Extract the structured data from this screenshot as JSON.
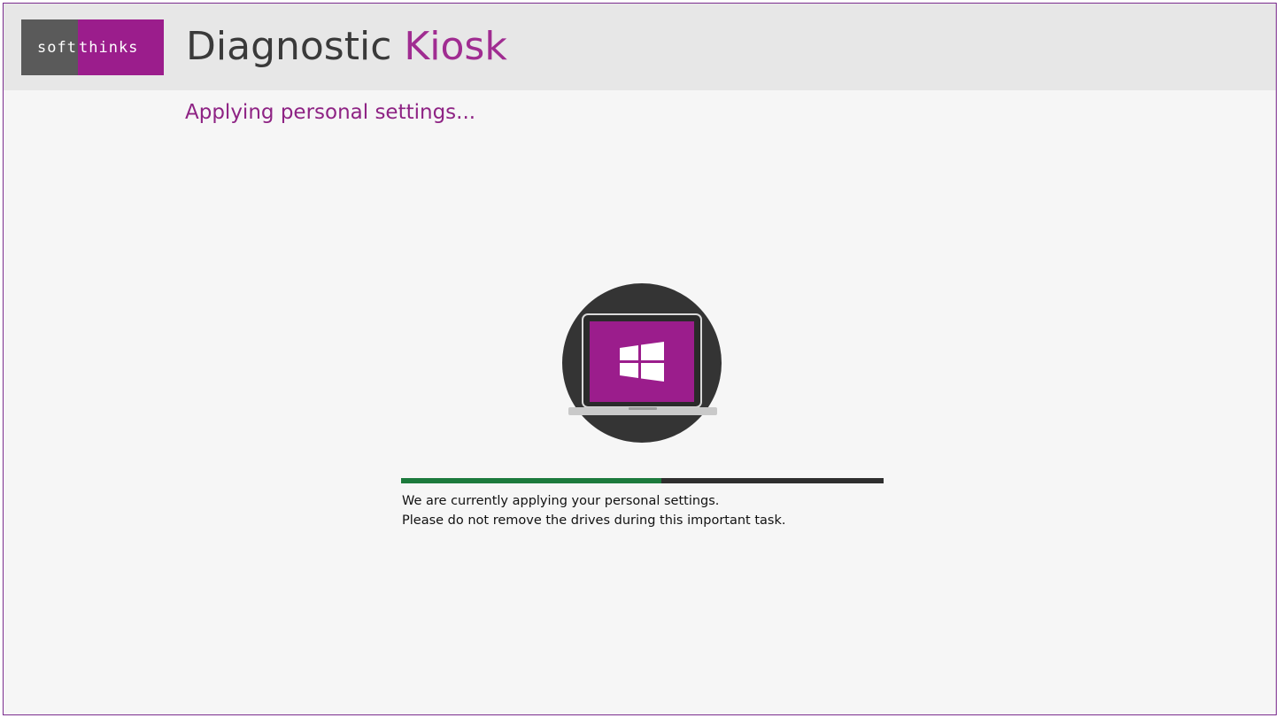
{
  "header": {
    "logo": {
      "left_text": "soft",
      "right_text": "thinks"
    },
    "app_title_main": "Diagnostic",
    "app_title_accent": "Kiosk"
  },
  "status": {
    "title": "Applying personal settings..."
  },
  "illustration": {
    "icon": "laptop-windows-icon"
  },
  "progress": {
    "fraction": 0.54
  },
  "message": {
    "line1": "We are currently applying your personal settings.",
    "line2": "Please do not remove the drives during this important task."
  },
  "colors": {
    "brand_purple": "#9b1d8c",
    "progress_green": "#1c7a3c",
    "progress_track": "#2e2e2e",
    "header_bg": "#e7e7e7"
  }
}
